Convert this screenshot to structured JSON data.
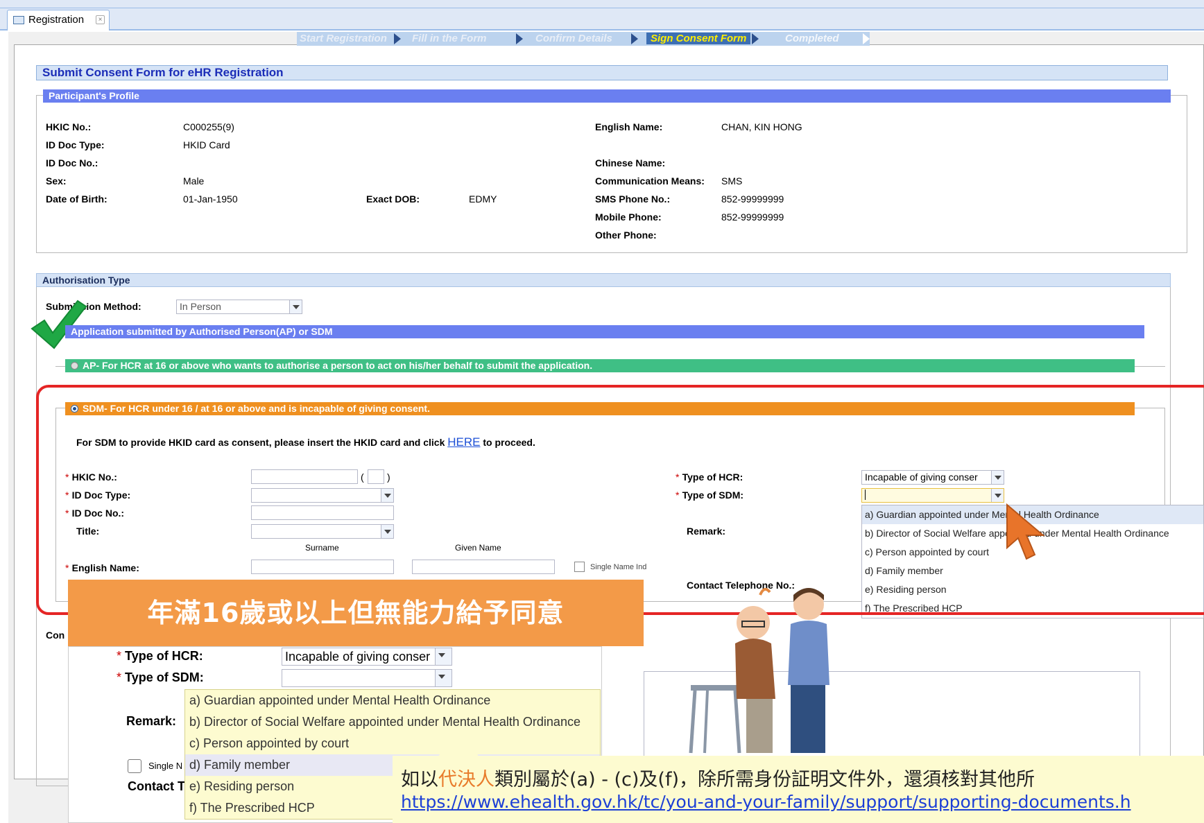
{
  "tab": {
    "label": "Registration",
    "close_glyph": "×"
  },
  "steps": [
    {
      "label": "Start Registration",
      "state": "done"
    },
    {
      "label": "Fill in the Form",
      "state": "done"
    },
    {
      "label": "Confirm Details",
      "state": "done"
    },
    {
      "label": "Sign Consent Form",
      "state": "active"
    },
    {
      "label": "Completed",
      "state": "pending"
    }
  ],
  "page_title": "Submit Consent Form for eHR Registration",
  "profile": {
    "legend": "Participant's Profile",
    "hkic_label": "HKIC No.:",
    "hkic_value": "C000255(9)",
    "id_doc_type_label": "ID Doc Type:",
    "id_doc_type_value": "HKID Card",
    "id_doc_no_label": "ID Doc No.:",
    "sex_label": "Sex:",
    "sex_value": "Male",
    "dob_label": "Date of Birth:",
    "dob_value": "01-Jan-1950",
    "exact_dob_label": "Exact DOB:",
    "exact_dob_value": "EDMY",
    "english_name_label": "English Name:",
    "english_name_value": "CHAN, KIN HONG",
    "chinese_name_label": "Chinese Name:",
    "comm_means_label": "Communication Means:",
    "comm_means_value": "SMS",
    "sms_label": "SMS Phone No.:",
    "sms_value": "852-99999999",
    "mobile_label": "Mobile Phone:",
    "mobile_value": "852-99999999",
    "other_phone_label": "Other Phone:"
  },
  "auth": {
    "heading": "Authorisation Type",
    "submission_method_label": "Submission Method:",
    "submission_method_value": "In Person",
    "ap_sdm_bar": "Application submitted by Authorised Person(AP) or SDM",
    "ap_option": "AP- For HCR at 16 or above who wants to authorise a person to act on his/her behalf to submit the application.",
    "sdm_option": "SDM- For HCR under 16 / at 16 or above and is incapable of giving consent.",
    "hkid_note_before": "For SDM to provide HKID card as consent, please insert the HKID card and click",
    "hkid_note_link": "HERE",
    "hkid_note_after": "to proceed."
  },
  "sdm_form": {
    "hkic_label": "HKIC No.:",
    "hkic_paren_open": "(",
    "hkic_paren_close": ")",
    "id_doc_type_label": "ID Doc Type:",
    "id_doc_no_label": "ID Doc No.:",
    "title_label": "Title:",
    "surname_hint": "Surname",
    "given_name_hint": "Given Name",
    "english_name_label": "English Name:",
    "single_name_label": "Single Name Ind",
    "type_hcr_label": "Type of HCR:",
    "type_hcr_value": "Incapable of giving conser",
    "type_sdm_label": "Type of SDM:",
    "remark_label": "Remark:",
    "contact_label": "Contact Telephone No.:",
    "required_mark": "*"
  },
  "sdm_options": [
    "a) Guardian appointed under Mental Health Ordinance",
    "b) Director of Social Welfare appointed under Mental Health Ordinance",
    "c) Person appointed by court",
    "d) Family member",
    "e) Residing person",
    "f) The Prescribed HCP"
  ],
  "left_cut_label": "Con",
  "callout": {
    "heading": "年滿16歲或以上但無能力給予同意",
    "type_hcr_label": "Type of HCR:",
    "type_hcr_value": "Incapable of giving conser",
    "type_sdm_label": "Type of SDM:",
    "remark_label": "Remark:",
    "single_label": "Single N",
    "contact_label": "Contact T",
    "required_mark": "*"
  },
  "note": {
    "text_prefix": "如以",
    "text_highlight": "代決人",
    "text_suffix": "類別屬於(a) - (c)及(f)，除所需身份証明文件外，還須核對其他所",
    "link": "https://www.ehealth.gov.hk/tc/you-and-your-family/support/supporting-documents.h"
  },
  "colors": {
    "accent_blue": "#6a7ff0",
    "ap_green": "#3fbf85",
    "sdm_orange": "#ef9020",
    "highlight_red": "#e52525",
    "callout_orange": "#f39a48",
    "note_highlight": "#e87b2b"
  },
  "icons": {
    "check": "green-check-icon",
    "cursor": "mouse-pointer-icon"
  }
}
